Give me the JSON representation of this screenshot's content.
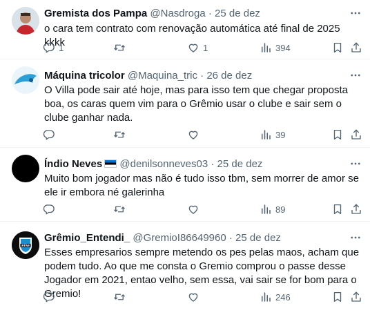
{
  "tweets": [
    {
      "name": "Gremista dos Pampa",
      "handle": "@Nasdroga",
      "sep": "·",
      "date": "25 de dez",
      "text": "o cara tem contrato com renovação automática até final de 2025 kkkk",
      "replies": "1",
      "retweets": "",
      "likes": "1",
      "views": "394"
    },
    {
      "name": "Máquina tricolor",
      "handle": "@Maquina_tric",
      "sep": "·",
      "date": "26 de dez",
      "text": "O Villa pode sair até hoje, mas para isso tem que chegar proposta boa, os caras quem vim para o Grêmio usar o clube e sair sem o clube ganhar nada.",
      "replies": "",
      "retweets": "",
      "likes": "",
      "views": "39"
    },
    {
      "name": "Índio Neves",
      "handle": "@denilsonneves03",
      "sep": "·",
      "date": "25 de dez",
      "text": "Muito bom jogador mas não é tudo isso tbm, sem morrer de amor se ele ir embora né galerinha",
      "replies": "",
      "retweets": "",
      "likes": "",
      "views": "89"
    },
    {
      "name": "Grêmio_Entendi_",
      "handle": "@GremioI86649960",
      "sep": "·",
      "date": "25 de dez",
      "text": "Esses empresarios sempre metendo os pes pelas maos, acham que podem tudo. Ao que me consta o Gremio comprou o passe desse Jogador em 2021, entao velho, sem essa, vai sair se for bom para o Gremio!",
      "replies": "",
      "retweets": "",
      "likes": "",
      "views": "246"
    }
  ],
  "avatar_texts": {
    "gremio_logo": "GRÊMIO"
  },
  "colors": {
    "text": "#0f1419",
    "muted": "#536471",
    "divider": "#eff3f4"
  }
}
